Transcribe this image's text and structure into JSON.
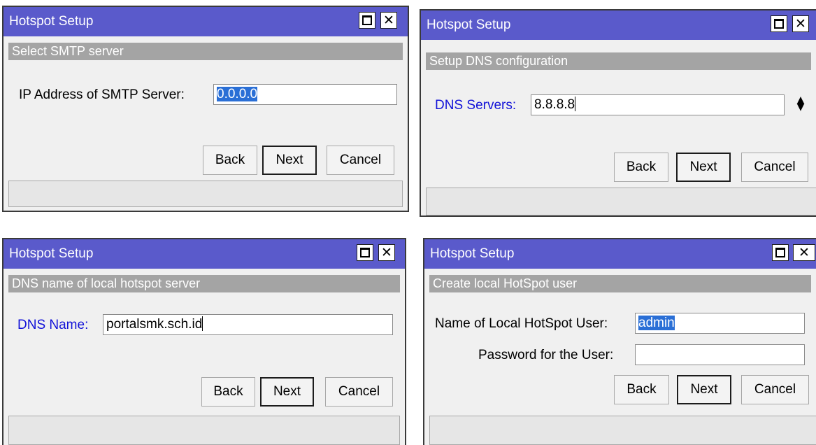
{
  "dialogs": [
    {
      "title": "Hotspot Setup",
      "section": "Select SMTP server",
      "field_label": "IP Address of SMTP Server:",
      "field_value": "0.0.0.0",
      "buttons": {
        "back": "Back",
        "next": "Next",
        "cancel": "Cancel"
      }
    },
    {
      "title": "Hotspot Setup",
      "section": "Setup DNS configuration",
      "field_label": "DNS Servers:",
      "field_value": "8.8.8.8",
      "buttons": {
        "back": "Back",
        "next": "Next",
        "cancel": "Cancel"
      }
    },
    {
      "title": "Hotspot Setup",
      "section": "DNS name of local hotspot server",
      "field_label": "DNS Name:",
      "field_value": "portalsmk.sch.id",
      "buttons": {
        "back": "Back",
        "next": "Next",
        "cancel": "Cancel"
      }
    },
    {
      "title": "Hotspot Setup",
      "section": "Create local HotSpot user",
      "field_label": "Name of Local HotSpot User:",
      "field_value": "admin",
      "field2_label": "Password for the User:",
      "field2_value": "",
      "buttons": {
        "back": "Back",
        "next": "Next",
        "cancel": "Cancel"
      }
    }
  ],
  "icons": {
    "maximize": "maximize-icon",
    "close": "close-icon",
    "spinner": "spinner-updown-icon"
  },
  "colors": {
    "titlebar": "#5a5acb",
    "section_header": "#a4a4a4",
    "blue_label": "#1212d8",
    "selection": "#2a6fd6"
  }
}
